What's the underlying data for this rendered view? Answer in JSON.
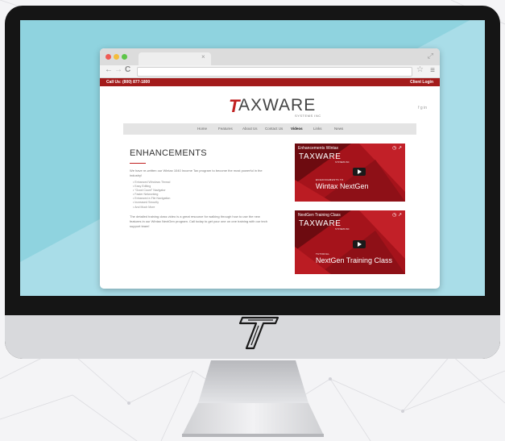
{
  "browser": {
    "tab_close": "×",
    "icons": {
      "back": "back-arrow-icon",
      "forward": "forward-arrow-icon",
      "reload": "reload-icon",
      "star": "star-icon",
      "menu": "hamburger-menu-icon",
      "resize": "resize-icon"
    },
    "back_glyph": "←",
    "forward_glyph": "→",
    "reload_glyph": "C",
    "star_glyph": "☆",
    "menu_glyph": "≡",
    "resize_glyph": "⤢"
  },
  "site": {
    "phone": "Call Us: (800) 877-1800",
    "client_login": "Client Login",
    "logo_mark": "T",
    "logo_text": "AXWARE",
    "logo_sub": "SYSTEMS INC",
    "social": "f  g  in",
    "nav": [
      "Home",
      "Features",
      "About Us",
      "Contact Us",
      "Videos",
      "Links",
      "News"
    ],
    "nav_active": "Videos",
    "page_title": "ENHANCEMENTS",
    "intro": "We have re-written our Wintax 1040 Income Tax program to become the most powerful in the industry!",
    "bullets": [
      "Enhanced Windows Thread",
      "Easy Editing",
      "\"Good Count\" Navigator",
      "Faster Networking",
      "Enhanced e-File Navigation",
      "Increased Security",
      "And Much More"
    ],
    "closing": "The detailed training class video is a great resource for walking through how to use the new features in our Wintax NextGen program. Call today to get your one on one training with our tech support team!"
  },
  "videos": [
    {
      "title": "Enhancements Wintax",
      "logo": "TAXWARE",
      "logo_sub": "SYSTEMS INC",
      "label": "ENHANCEMENTS TO",
      "name": "Wintax NextGen",
      "icons": "◷ ↗"
    },
    {
      "title": "NextGen Training Class",
      "logo": "TAXWARE",
      "logo_sub": "SYSTEMS INC",
      "label": "TUTORIAL",
      "name": "NextGen Training Class",
      "icons": "◷ ↗"
    }
  ],
  "colors": {
    "brand_red": "#a31b1b",
    "screen_cyan": "#8fd3df",
    "monitor_bezel": "#151515"
  }
}
